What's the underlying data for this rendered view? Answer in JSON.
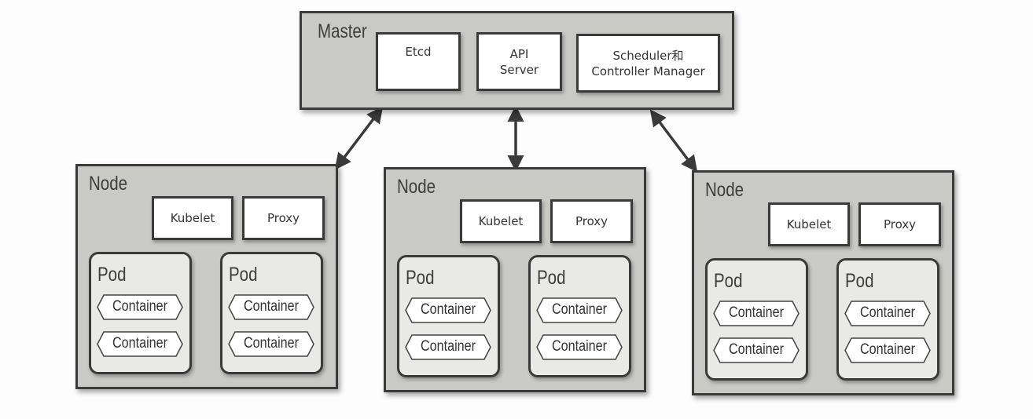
{
  "master": {
    "title": "Master",
    "components": [
      "Etcd",
      "API\nServer",
      "Scheduler和\nController Manager"
    ]
  },
  "nodes": [
    {
      "title": "Node",
      "kubelet": "Kubelet",
      "proxy": "Proxy",
      "pods": [
        {
          "title": "Pod",
          "containers": [
            "Container",
            "Container"
          ]
        },
        {
          "title": "Pod",
          "containers": [
            "Container",
            "Container"
          ]
        }
      ]
    },
    {
      "title": "Node",
      "kubelet": "Kubelet",
      "proxy": "Proxy",
      "pods": [
        {
          "title": "Pod",
          "containers": [
            "Container",
            "Container"
          ]
        },
        {
          "title": "Pod",
          "containers": [
            "Container",
            "Container"
          ]
        }
      ]
    },
    {
      "title": "Node",
      "kubelet": "Kubelet",
      "proxy": "Proxy",
      "pods": [
        {
          "title": "Pod",
          "containers": [
            "Container",
            "Container"
          ]
        },
        {
          "title": "Pod",
          "containers": [
            "Container",
            "Container"
          ]
        }
      ]
    }
  ],
  "colors": {
    "panel": "#c9c9c6",
    "border": "#3a3a3a",
    "pod": "#e9e9e6"
  }
}
